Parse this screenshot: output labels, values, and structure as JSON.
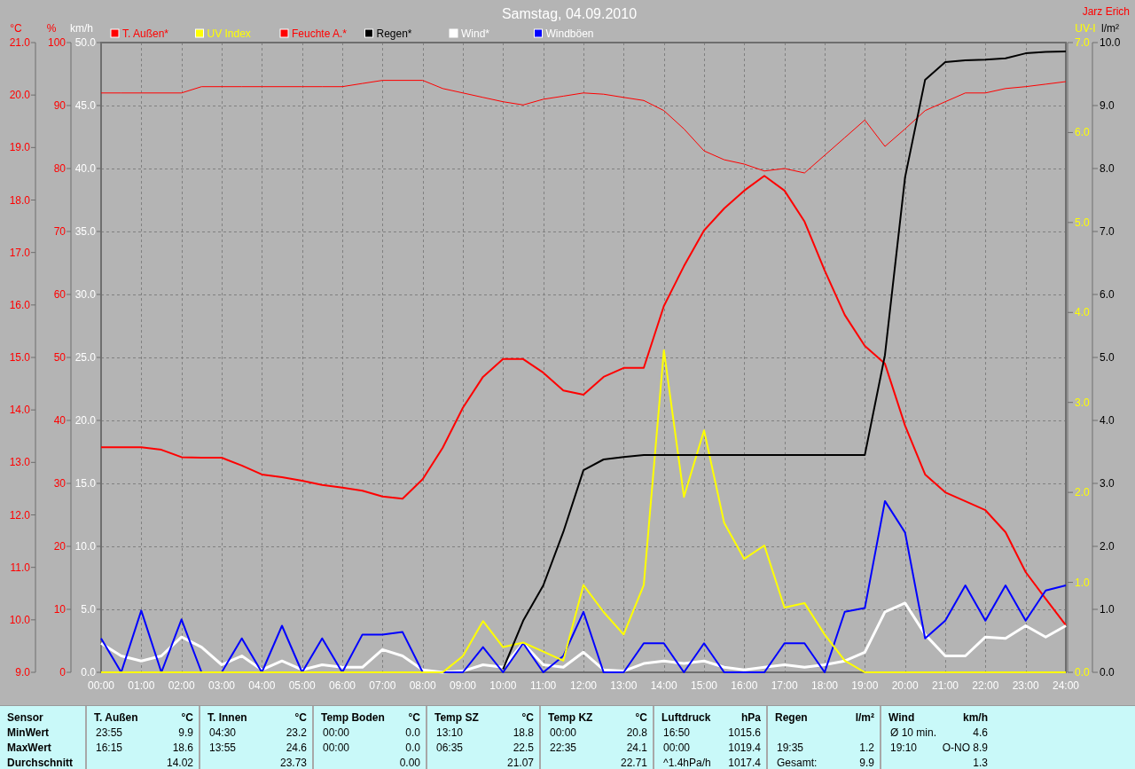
{
  "title": "Samstag, 04.09.2010",
  "author": "Jarz Erich",
  "temperature_humidity_wind": {
    "chart_data": {
      "type": "line",
      "grid": true,
      "legend": "top",
      "xlim": [
        0,
        24
      ],
      "x": [
        0,
        0.5,
        1,
        1.5,
        2,
        2.5,
        3,
        3.5,
        4,
        4.5,
        5,
        5.5,
        6,
        6.5,
        7,
        7.5,
        8,
        8.5,
        9,
        9.5,
        10,
        10.5,
        11,
        11.5,
        12,
        12.5,
        13,
        13.5,
        14,
        14.5,
        15,
        15.5,
        16,
        16.5,
        17,
        17.5,
        18,
        18.5,
        19,
        19.5,
        20,
        20.5,
        21,
        21.5,
        22,
        22.5,
        23,
        23.5,
        24
      ],
      "xticks": [
        {
          "value": 0,
          "label": "00:00"
        },
        {
          "value": 1,
          "label": "01:00"
        },
        {
          "value": 2,
          "label": "02:00"
        },
        {
          "value": 3,
          "label": "03:00"
        },
        {
          "value": 4,
          "label": "04:00"
        },
        {
          "value": 5,
          "label": "05:00"
        },
        {
          "value": 6,
          "label": "06:00"
        },
        {
          "value": 7,
          "label": "07:00"
        },
        {
          "value": 8,
          "label": "08:00"
        },
        {
          "value": 9,
          "label": "09:00"
        },
        {
          "value": 10,
          "label": "10:00"
        },
        {
          "value": 11,
          "label": "11:00"
        },
        {
          "value": 12,
          "label": "12:00"
        },
        {
          "value": 13,
          "label": "13:00"
        },
        {
          "value": 14,
          "label": "14:00"
        },
        {
          "value": 15,
          "label": "15:00"
        },
        {
          "value": 16,
          "label": "16:00"
        },
        {
          "value": 17,
          "label": "17:00"
        },
        {
          "value": 18,
          "label": "18:00"
        },
        {
          "value": 19,
          "label": "19:00"
        },
        {
          "value": 20,
          "label": "20:00"
        },
        {
          "value": 21,
          "label": "21:00"
        },
        {
          "value": 22,
          "label": "22:00"
        },
        {
          "value": 23,
          "label": "23:00"
        },
        {
          "value": 24,
          "label": "24:00"
        }
      ],
      "ylabel": "°C",
      "ylim": [
        9,
        21
      ],
      "yticks": [
        {
          "value": 9,
          "label": "9.0"
        },
        {
          "value": 10,
          "label": "10.0"
        },
        {
          "value": 11,
          "label": "11.0"
        },
        {
          "value": 12,
          "label": "12.0"
        },
        {
          "value": 13,
          "label": "13.0"
        },
        {
          "value": 14,
          "label": "14.0"
        },
        {
          "value": 15,
          "label": "15.0"
        },
        {
          "value": 16,
          "label": "16.0"
        },
        {
          "value": 17,
          "label": "17.0"
        },
        {
          "value": 18,
          "label": "18.0"
        },
        {
          "value": 19,
          "label": "19.0"
        },
        {
          "value": 20,
          "label": "20.0"
        },
        {
          "value": 21,
          "label": "21.0"
        }
      ],
      "y2label": "%",
      "y2lim": [
        0,
        100
      ],
      "y2ticks": [
        0,
        10,
        20,
        30,
        40,
        50,
        60,
        70,
        80,
        90,
        100
      ],
      "y3label": "km/h",
      "y3lim": [
        0,
        50
      ],
      "y3ticks": [
        {
          "value": 0,
          "label": "0.0"
        },
        {
          "value": 5,
          "label": "5.0"
        },
        {
          "value": 10,
          "label": "10.0"
        },
        {
          "value": 15,
          "label": "15.0"
        },
        {
          "value": 20,
          "label": "20.0"
        },
        {
          "value": 25,
          "label": "25.0"
        },
        {
          "value": 30,
          "label": "30.0"
        },
        {
          "value": 35,
          "label": "35.0"
        },
        {
          "value": 40,
          "label": "40.0"
        },
        {
          "value": 45,
          "label": "45.0"
        },
        {
          "value": 50,
          "label": "50.0"
        }
      ],
      "series": [
        {
          "name": "T. Außen*",
          "color": "#ff0000",
          "values": [
            13.29,
            13.29,
            13.29,
            13.24,
            13.1,
            13.09,
            13.09,
            12.94,
            12.77,
            12.72,
            12.65,
            12.57,
            12.52,
            12.46,
            12.35,
            12.31,
            12.68,
            13.28,
            14.04,
            14.63,
            14.97,
            14.97,
            14.71,
            14.37,
            14.29,
            14.63,
            14.8,
            14.8,
            15.98,
            16.74,
            17.42,
            17.84,
            18.18,
            18.46,
            18.18,
            17.59,
            16.66,
            15.81,
            15.22,
            14.88,
            13.7,
            12.77,
            12.43,
            12.26,
            12.09,
            11.67,
            10.91,
            10.4,
            9.9
          ]
        },
        {
          "name": "Feuchte A.*",
          "color": "#ff0000",
          "axis": "y2",
          "values": [
            92,
            92,
            92,
            92,
            92,
            93,
            93,
            93,
            93,
            93,
            93,
            93,
            93,
            93.5,
            94,
            94,
            94,
            92.7,
            92,
            91.3,
            90.6,
            90.1,
            91,
            91.5,
            92,
            91.8,
            91.3,
            90.8,
            89.2,
            86.3,
            82.8,
            81.4,
            80.7,
            79.6,
            80,
            79.3,
            82.1,
            84.9,
            87.7,
            83.5,
            86.3,
            89.2,
            90.6,
            92,
            92,
            92.7,
            93,
            93.4,
            93.8
          ]
        },
        {
          "name": "Wind*",
          "color": "#ffffff",
          "axis": "y3",
          "values": [
            2.3,
            1.3,
            0.9,
            1.3,
            2.8,
            2,
            0.6,
            1.3,
            0.2,
            0.9,
            0.2,
            0.6,
            0.4,
            0.4,
            1.8,
            1.3,
            0.2,
            0,
            0.1,
            0.6,
            0.4,
            2.3,
            0.6,
            0.4,
            1.6,
            0.2,
            0.1,
            0.7,
            0.9,
            0.7,
            0.9,
            0.4,
            0.2,
            0.4,
            0.6,
            0.4,
            0.6,
            0.9,
            1.6,
            4.8,
            5.5,
            3,
            1.3,
            1.3,
            2.8,
            2.7,
            3.7,
            2.8,
            3.7
          ]
        },
        {
          "name": "Windböen",
          "color": "#0000ff",
          "axis": "y3",
          "values": [
            2.7,
            0,
            4.9,
            0,
            4.2,
            0,
            0,
            2.7,
            0,
            3.7,
            0,
            2.7,
            0,
            3,
            3,
            3.2,
            0,
            0,
            0,
            2,
            0,
            2.3,
            0,
            1.3,
            4.8,
            0,
            0,
            2.3,
            2.3,
            0,
            2.3,
            0,
            0,
            0,
            2.3,
            2.3,
            0,
            4.8,
            5.1,
            13.6,
            11.1,
            2.7,
            4.1,
            6.9,
            4.1,
            6.9,
            4.1,
            6.5,
            6.9
          ]
        }
      ]
    }
  },
  "uv_rain": {
    "chart_data": {
      "type": "line",
      "legend": "top",
      "xlim": [
        0,
        24
      ],
      "x": [
        0,
        0.5,
        1,
        1.5,
        2,
        2.5,
        3,
        3.5,
        4,
        4.5,
        5,
        5.5,
        6,
        6.5,
        7,
        7.5,
        8,
        8.5,
        9,
        9.5,
        10,
        10.5,
        11,
        11.5,
        12,
        12.5,
        13,
        13.5,
        14,
        14.5,
        15,
        15.5,
        16,
        16.5,
        17,
        17.5,
        18,
        18.5,
        19,
        19.5,
        20,
        20.5,
        21,
        21.5,
        22,
        22.5,
        23,
        23.5,
        24
      ],
      "ylabel": "UV-I",
      "ylim": [
        0,
        7
      ],
      "yticks": [
        {
          "value": 0,
          "label": "0.0"
        },
        {
          "value": 1,
          "label": "1.0"
        },
        {
          "value": 2,
          "label": "2.0"
        },
        {
          "value": 3,
          "label": "3.0"
        },
        {
          "value": 4,
          "label": "4.0"
        },
        {
          "value": 5,
          "label": "5.0"
        },
        {
          "value": 6,
          "label": "6.0"
        },
        {
          "value": 7,
          "label": "7.0"
        }
      ],
      "y2label": "l/m²",
      "y2lim": [
        0,
        10
      ],
      "y2ticks": [
        {
          "value": 0,
          "label": "0.0"
        },
        {
          "value": 1,
          "label": "1.0"
        },
        {
          "value": 2,
          "label": "2.0"
        },
        {
          "value": 3,
          "label": "3.0"
        },
        {
          "value": 4,
          "label": "4.0"
        },
        {
          "value": 5,
          "label": "5.0"
        },
        {
          "value": 6,
          "label": "6.0"
        },
        {
          "value": 7,
          "label": "7.0"
        },
        {
          "value": 8,
          "label": "8.0"
        },
        {
          "value": 9,
          "label": "9.0"
        },
        {
          "value": 10,
          "label": "10.0"
        }
      ],
      "series": [
        {
          "name": "UV Index",
          "color": "#ffff00",
          "values": [
            0,
            0,
            0,
            0,
            0,
            0,
            0,
            0,
            0,
            0,
            0,
            0,
            0,
            0,
            0,
            0,
            0,
            0,
            0.18,
            0.57,
            0.28,
            0.33,
            0.23,
            0.13,
            0.97,
            0.67,
            0.42,
            0.97,
            3.58,
            1.95,
            2.69,
            1.66,
            1.26,
            1.41,
            0.72,
            0.77,
            0.42,
            0.13,
            0,
            0,
            0,
            0,
            0,
            0,
            0,
            0,
            0,
            0,
            0
          ]
        },
        {
          "name": "Regen*",
          "color": "#000000",
          "axis": "y2",
          "values": [
            null,
            null,
            null,
            null,
            null,
            null,
            null,
            null,
            null,
            null,
            null,
            null,
            null,
            null,
            null,
            null,
            null,
            null,
            null,
            null,
            0.05,
            0.82,
            1.38,
            2.23,
            3.21,
            3.38,
            3.42,
            3.45,
            3.45,
            3.45,
            3.45,
            3.45,
            3.45,
            3.45,
            3.45,
            3.45,
            3.45,
            3.45,
            3.45,
            5.04,
            7.86,
            9.41,
            9.69,
            9.72,
            9.73,
            9.75,
            9.83,
            9.85,
            9.86
          ]
        }
      ]
    }
  },
  "stats": {
    "row_labels": [
      "Sensor",
      "MinWert",
      "MaxWert",
      "Durchschnitt"
    ],
    "sensors": [
      {
        "name": "T. Außen",
        "unit": "°C",
        "min": {
          "time": "23:55",
          "value": "9.9"
        },
        "max": {
          "time": "16:15",
          "value": "18.6"
        },
        "average": {
          "value": "14.02"
        }
      },
      {
        "name": "T. Innen",
        "unit": "°C",
        "min": {
          "time": "04:30",
          "value": "23.2"
        },
        "max": {
          "time": "13:55",
          "value": "24.6"
        },
        "average": {
          "value": "23.73"
        }
      },
      {
        "name": "Temp Boden",
        "unit": "°C",
        "min": {
          "time": "00:00",
          "value": "0.0"
        },
        "max": {
          "time": "00:00",
          "value": "0.0"
        },
        "average": {
          "value": "0.00"
        }
      },
      {
        "name": "Temp SZ",
        "unit": "°C",
        "min": {
          "time": "13:10",
          "value": "18.8"
        },
        "max": {
          "time": "06:35",
          "value": "22.5"
        },
        "average": {
          "value": "21.07"
        }
      },
      {
        "name": "Temp KZ",
        "unit": "°C",
        "min": {
          "time": "00:00",
          "value": "20.8"
        },
        "max": {
          "time": "22:35",
          "value": "24.1"
        },
        "average": {
          "value": "22.71"
        }
      },
      {
        "name": "Luftdruck",
        "unit": "hPa",
        "min": {
          "time": "16:50",
          "value": "1015.6"
        },
        "max": {
          "time": "00:00",
          "value": "1019.4"
        },
        "average": {
          "time": "^1.4hPa/h",
          "value": "1017.4"
        }
      },
      {
        "name": "Regen",
        "unit": "l/m²",
        "max": {
          "time": "19:35",
          "value": "1.2"
        },
        "average": {
          "time": "Gesamt:",
          "value": "9.9"
        }
      },
      {
        "name": "Wind",
        "unit": "km/h",
        "min": {
          "time": "Ø 10 min.",
          "value": "4.6"
        },
        "max": {
          "time": "19:10",
          "value": "O-NO 8.9"
        },
        "average": {
          "value": "1.3"
        }
      }
    ]
  }
}
